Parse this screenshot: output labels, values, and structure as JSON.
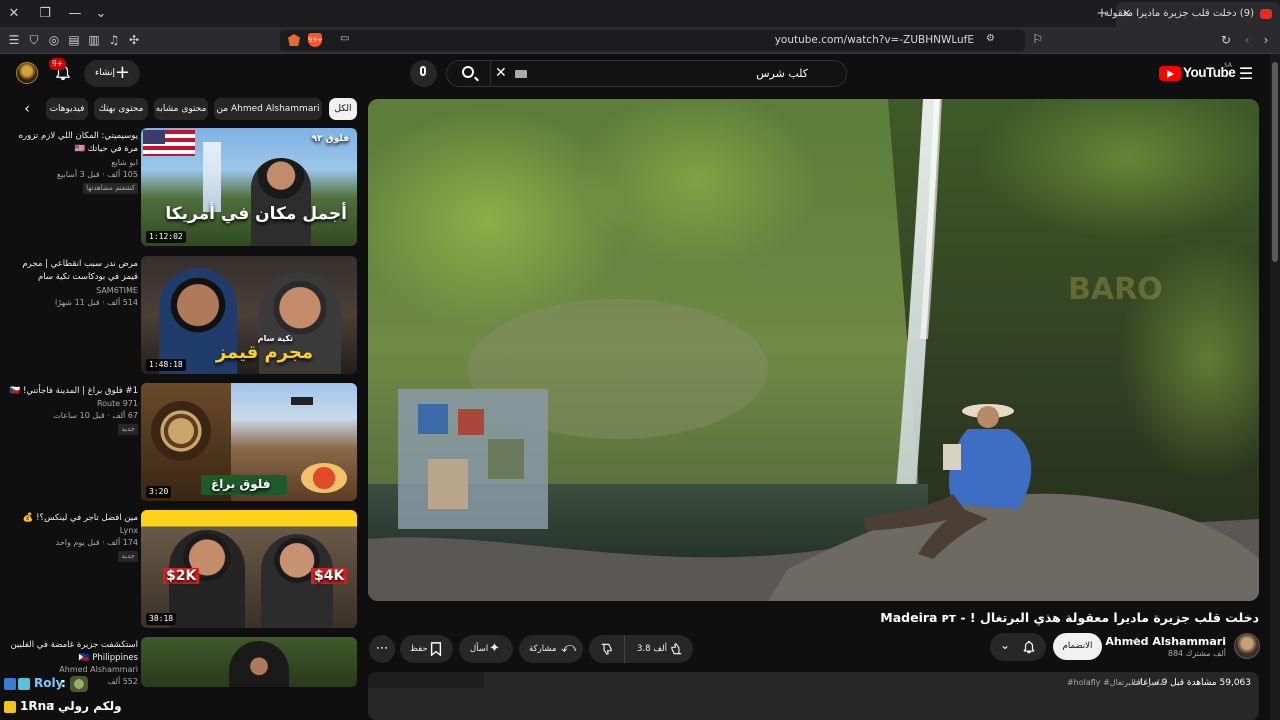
{
  "browser": {
    "tab_title": "(9) دخلت قلب جزيرة ماديرا معقولة",
    "url": "youtube.com/watch?v=-ZUBHNWLufE",
    "shield_count": "99+"
  },
  "masthead": {
    "logo_text": "YouTube",
    "logo_region": "SA",
    "search_query": "كلب شرس",
    "create_label": "إنشاء",
    "notification_count": "9+"
  },
  "chips": [
    "الكل",
    "من Ahmed Alshammari",
    "محتوى مشابه",
    "محتوى بهتك",
    "فيديوهات"
  ],
  "recommendations": [
    {
      "title": "يوسيميتي: المكان اللي لازم تزوره مرة في حياتك 🇺🇸",
      "channel": "ابو شايع",
      "views": "105 ألف",
      "age": "قبل 3 أسابيع",
      "badge": "كشفتم مشاهدتها",
      "duration": "1:12:02",
      "thumb_title": "أجمل مكان في أمريكا",
      "thumb_sub": "فلوق ٩٢"
    },
    {
      "title": "مرض ندر سبب انقطاعي | مجرم قيمز في بودكاست تكية سام",
      "channel": "SAM6TIME",
      "views": "514 ألف",
      "age": "قبل 11 شهرًا",
      "badge": "",
      "duration": "1:48:18",
      "thumb_title": "مجرم قيمز",
      "thumb_sub": "تكية سام"
    },
    {
      "title": "#1 فلوق براغ | المدينة فاجأتني! 🇨🇿",
      "channel": "Route 971",
      "views": "67 ألف",
      "age": "قبل 10 ساعات",
      "badge": "جديد",
      "duration": "3:20",
      "thumb_title": "فلوق براغ",
      "thumb_sub": ""
    },
    {
      "title": "مين افضل تاجر في لينكس؟! 💰",
      "channel": "Lynx",
      "views": "174 ألف",
      "age": "قبل يوم واحد",
      "badge": "جديد",
      "duration": "38:18",
      "thumb_title": "$2K",
      "thumb_sub": "$4K"
    },
    {
      "title": "استكشفت جزيرة غامضة في الفلبين 🇵🇭 Philippines",
      "channel": "Ahmed Alshammari",
      "views": "552 ألف",
      "age": "",
      "badge": "",
      "duration": "",
      "thumb_title": "",
      "thumb_sub": ""
    }
  ],
  "video": {
    "title": "دخلت قلب جزيرة ماديرا معقولة هذي البرتغال ! - Madeira ᴘᴛ",
    "channel_name": "Ahmed Alshammari",
    "subscribers": "884 ألف مشترك",
    "join_label": "الانضمام",
    "likes": "3.8 ألف",
    "share_label": "مشاركة",
    "ask_label": "اسأل",
    "save_label": "حفظ",
    "views_age": "59,063 مشاهدة قبل 9 ساعات",
    "hashtags": "#holafly #ماديرا #البرتغال",
    "watermark": "BARO"
  },
  "chat": {
    "line1_user": "Roly",
    "line2_user": "1Rna",
    "line2_text": "ولكم رولي"
  },
  "colors": {
    "background": "#0f0f0f",
    "surface": "#272727",
    "brand_red": "#ff0000",
    "badge_red": "#cc0000",
    "text": "#f1f1f1",
    "secondary": "#aaaaaa"
  }
}
